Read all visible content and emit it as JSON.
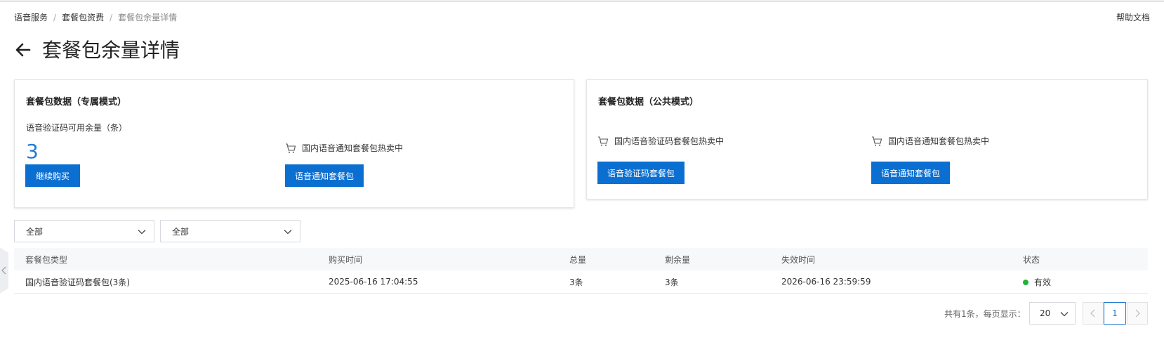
{
  "breadcrumb": {
    "items": [
      "语音服务",
      "套餐包资费"
    ],
    "current": "套餐包余量详情"
  },
  "help_link": "帮助文档",
  "page_title": "套餐包余量详情",
  "card_exclusive": {
    "title": "套餐包数据（专属模式）",
    "available_label": "语音验证码可用余量（条）",
    "available_value": "3",
    "buy_button": "继续购买",
    "promo_text": "国内语音通知套餐包热卖中",
    "promo_button": "语音通知套餐包"
  },
  "card_public": {
    "title": "套餐包数据（公共模式）",
    "promo1_text": "国内语音验证码套餐包热卖中",
    "promo1_button": "语音验证码套餐包",
    "promo2_text": "国内语音通知套餐包热卖中",
    "promo2_button": "语音通知套餐包"
  },
  "filters": {
    "filter1_value": "全部",
    "filter2_value": "全部"
  },
  "table": {
    "headers": [
      "套餐包类型",
      "购买时间",
      "总量",
      "剩余量",
      "失效时间",
      "状态"
    ],
    "rows": [
      [
        "国内语音验证码套餐包(3条)",
        "2025-06-16 17:04:55",
        "3条",
        "3条",
        "2026-06-16 23:59:59",
        "有效"
      ]
    ],
    "status_color": "#1fb33a"
  },
  "pagination": {
    "total_text": "共有1条，每页显示：",
    "page_size": "20",
    "current_page": "1"
  },
  "colors": {
    "primary": "#0a6fd1",
    "accent_text": "#1f7ad1"
  }
}
